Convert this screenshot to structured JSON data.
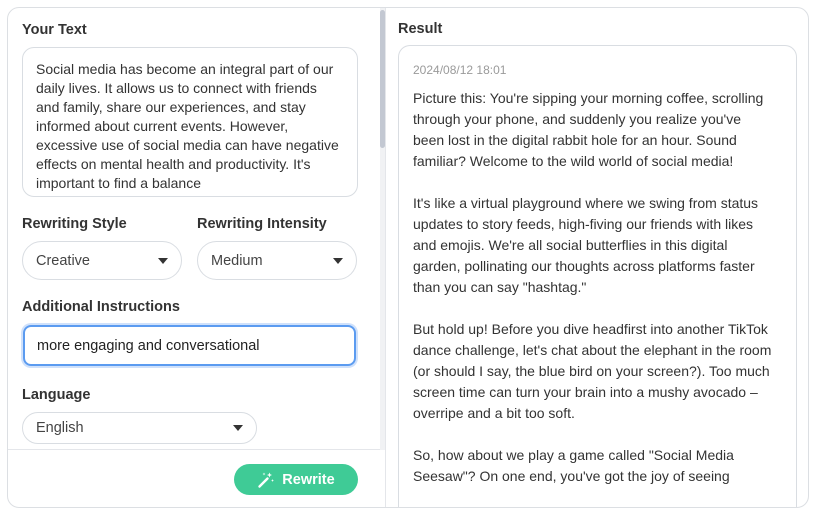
{
  "input": {
    "label": "Your Text",
    "text": "Social media has become an integral part of our daily lives. It allows us to connect with friends and family, share our experiences, and stay informed about current events. However, excessive use of social media can have negative effects on mental health and productivity. It's important to find a balance"
  },
  "style": {
    "label": "Rewriting Style",
    "value": "Creative"
  },
  "intensity": {
    "label": "Rewriting Intensity",
    "value": "Medium"
  },
  "instructions": {
    "label": "Additional Instructions",
    "value": "more engaging and conversational"
  },
  "language": {
    "label": "Language",
    "value": "English"
  },
  "rewrite_button": {
    "label": "Rewrite",
    "icon": "magic-wand-icon",
    "color": "#3fcb96"
  },
  "result": {
    "label": "Result",
    "timestamp": "2024/08/12 18:01",
    "paragraphs": [
      "Picture this: You're sipping your morning coffee, scrolling through your phone, and suddenly you realize you've been lost in the digital rabbit hole for an hour. Sound familiar? Welcome to the wild world of social media!",
      "It's like a virtual playground where we swing from status updates to story feeds, high-fiving our friends with likes and emojis. We're all social butterflies in this digital garden, pollinating our thoughts across platforms faster than you can say \"hashtag.\"",
      "But hold up! Before you dive headfirst into another TikTok dance challenge, let's chat about the elephant in the room (or should I say, the blue bird on your screen?). Too much screen time can turn your brain into a mushy avocado – overripe and a bit too soft.",
      "So, how about we play a game called \"Social Media Seesaw\"? On one end, you've got the joy of seeing"
    ]
  },
  "colors": {
    "accent_green": "#3fcb96",
    "focus_blue": "#5b9bf0"
  }
}
